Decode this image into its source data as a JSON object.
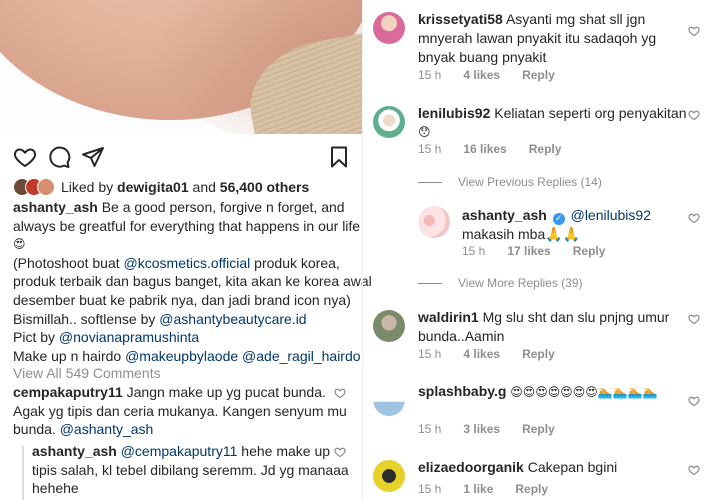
{
  "post": {
    "like_avatar_colors": [
      "#6b4a3a",
      "#c0392b",
      "#d98e6f"
    ],
    "liked_by_prefix": "Liked by ",
    "liked_by_user": "dewigita01",
    "liked_by_and": " and ",
    "likes_count": "56,400 others",
    "caption": {
      "username": "ashanty_ash",
      "line1": " Be a good person, forgive n forget, and",
      "line2": "always be greatful for everything that happens in our life",
      "line3_emoji": "😍",
      "line4_a": "(Photoshoot buat ",
      "line4_mention": "@kcosmetics.official",
      "line4_b": " produk korea,",
      "line5": "produk terbaik dan bagus banget, kita akan ke korea awal",
      "line6": "desember buat ke pabrik nya, dan jadi brand icon nya)",
      "line7_a": "Bismillah.. softlense by ",
      "line7_mention": "@ashantybeautycare.id",
      "line8_a": "Pict by ",
      "line8_mention": "@novianapramushinta",
      "line9_a": "Make up n hairdo ",
      "line9_mention1": "@makeupbylaode",
      "line9_sep": " ",
      "line9_mention2": "@ade_ragil_hairdo"
    },
    "view_all_comments": "View All 549 Comments"
  },
  "left_comments": {
    "c1": {
      "username": "cempakaputry11",
      "line1": " Jangn make up yg pucat bunda.",
      "line2": "Agak yg tipis dan ceria mukanya.  Kangen senyum mu",
      "line3_a": "bunda.  ",
      "line3_mention": "@ashanty_ash"
    },
    "c2": {
      "username": "ashanty_ash",
      "line1_a": " ",
      "line1_mention": "@cempakaputry11",
      "line1_b": " hehe make up",
      "line2": "tipis salah, kl tebel dibilang seremm. Jd yg manaaa",
      "line3": "hehehe"
    }
  },
  "right_comments": [
    {
      "username": "krissetyati58",
      "text_line1": " Asyanti mg shat sll jgn",
      "text_line2": "mnyerah lawan pnyakit itu sadaqoh yg",
      "text_line3": "bnyak buang pnyakit",
      "time": "15 h",
      "likes": "4 likes",
      "reply": "Reply",
      "avatar_color": "#d86b9a"
    },
    {
      "username": "lenilubis92",
      "text_line1": " Keliatan seperti org penyakitan",
      "text_line2": "😯",
      "time": "15 h",
      "likes": "16 likes",
      "reply": "Reply",
      "avatar_color": "#5fae8e"
    },
    {
      "view_replies": "View Previous Replies (14)"
    },
    {
      "username": "ashanty_ash",
      "mention": "@lenilubis92",
      "text_line2": "makasih mba🙏🙏",
      "time": "15 h",
      "likes": "17 likes",
      "reply": "Reply",
      "avatar_color": "#f2c4c4"
    },
    {
      "view_replies": "View More Replies (39)"
    },
    {
      "username": "waldirin1",
      "text_line1": " Mg slu sht dan slu pnjng umur",
      "text_line2": "bunda..Aamin",
      "time": "15 h",
      "likes": "4 likes",
      "reply": "Reply",
      "avatar_color": "#7a8a6a"
    },
    {
      "username": "splashbaby.g",
      "text_line1": " 😍😍😍😍😍😍😍🏊🏊🏊🏊",
      "time": "15 h",
      "likes": "3 likes",
      "reply": "Reply",
      "avatar_color": "#9fc3e0"
    },
    {
      "username": "elizaedoorganik",
      "text_line1": " Cakepan bgini",
      "time": "15 h",
      "likes": "1 like",
      "reply": "Reply",
      "avatar_color": "#e6d02a"
    }
  ],
  "icons": {
    "heart": "heart-outline-icon",
    "comment": "comment-bubble-icon",
    "share": "paper-plane-icon",
    "save": "bookmark-icon",
    "verified": "verified-badge-icon"
  },
  "colors": {
    "text": "#262626",
    "muted": "#8e8e8e",
    "mention": "#00376b",
    "verified": "#3897f0"
  }
}
